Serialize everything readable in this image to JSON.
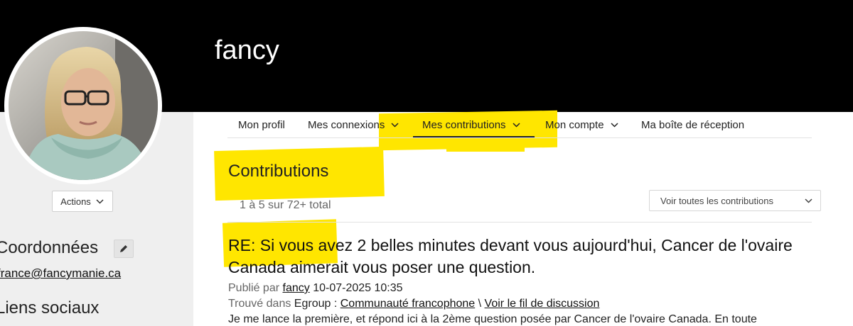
{
  "profile": {
    "name": "fancy",
    "actions_label": "Actions"
  },
  "sidebar": {
    "coordinates_title": "Coordonnées",
    "email": "france@fancymanie.ca",
    "social_title": "Liens sociaux"
  },
  "nav": {
    "items": [
      {
        "label": "Mon profil"
      },
      {
        "label": "Mes connexions"
      },
      {
        "label": "Mes contributions"
      },
      {
        "label": "Mon compte"
      },
      {
        "label": "Ma boîte de réception"
      }
    ]
  },
  "contributions": {
    "title": "Contributions",
    "count": "1 à 5 sur 72+ total",
    "filter_selected": "Voir toutes les contributions"
  },
  "post": {
    "title": "RE: Si vous avez 2 belles minutes devant vous aujourd'hui, Cancer de l'ovaire Canada aimerait vous poser une question.",
    "published_by_label": "Publié par",
    "author": "fancy",
    "datetime": "10-07-2025 10:35",
    "found_in_label": "Trouvé dans",
    "group_label": "Egroup :",
    "community": "Communauté francophone",
    "separator": "\\",
    "thread_link": "Voir le fil de discussion",
    "excerpt": "Je me lance la première, et répond ici à la 2ème question posée par Cancer de l'ovaire Canada. En toute"
  },
  "colors": {
    "header_bg": "#000000",
    "highlight": "#ffe600",
    "sidebar_bg": "#efefef"
  },
  "icons": [
    "chevron-down-icon",
    "pencil-icon"
  ]
}
